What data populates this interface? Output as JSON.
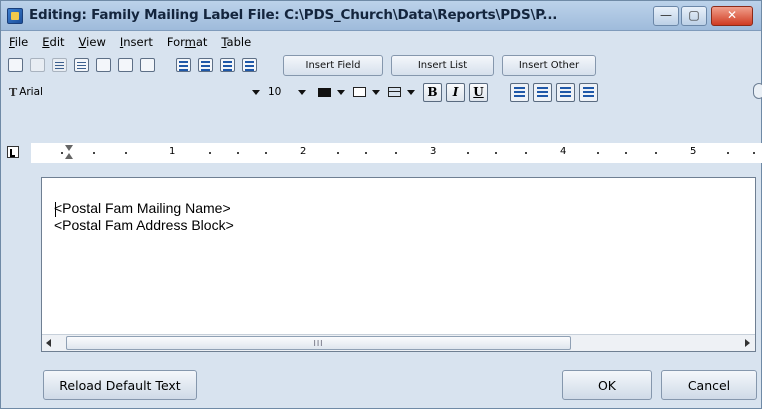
{
  "window": {
    "title": "Editing: Family Mailing Label   File: C:\\PDS_Church\\Data\\Reports\\PDS\\P...",
    "controls": {
      "minimize": "—",
      "maximize": "▢",
      "close": "✕"
    }
  },
  "menu": [
    {
      "key": "F",
      "rest": "ile"
    },
    {
      "key": "E",
      "rest": "dit"
    },
    {
      "key": "V",
      "rest": "iew"
    },
    {
      "key": "I",
      "rest": "nsert"
    },
    {
      "pre": "For",
      "key": "m",
      "rest": "at"
    },
    {
      "key": "T",
      "rest": "able"
    }
  ],
  "toolbar": {
    "icons": [
      "undo-icon",
      "cut-icon",
      "copy-icon",
      "paste-icon",
      "format-painter-icon",
      "find-replace-icon",
      "spell-check-icon",
      "bullet-list-icon",
      "numbered-list-icon",
      "indent-icon",
      "outdent-icon"
    ],
    "insert_field": "Insert Field",
    "insert_list": "Insert List",
    "insert_other": "Insert Other"
  },
  "format": {
    "font_icon": "T",
    "font": "Arial",
    "size": "10",
    "bold": "B",
    "italic": "I",
    "underline": "U"
  },
  "ruler": {
    "numbers": [
      "1",
      "2",
      "3",
      "4",
      "5"
    ]
  },
  "editor": {
    "line1": "<Postal Fam Mailing Name>",
    "line2": "<Postal Fam Address Block>",
    "scroll_grip": "III"
  },
  "buttons": {
    "reload": "Reload Default Text",
    "ok": "OK",
    "cancel": "Cancel"
  }
}
